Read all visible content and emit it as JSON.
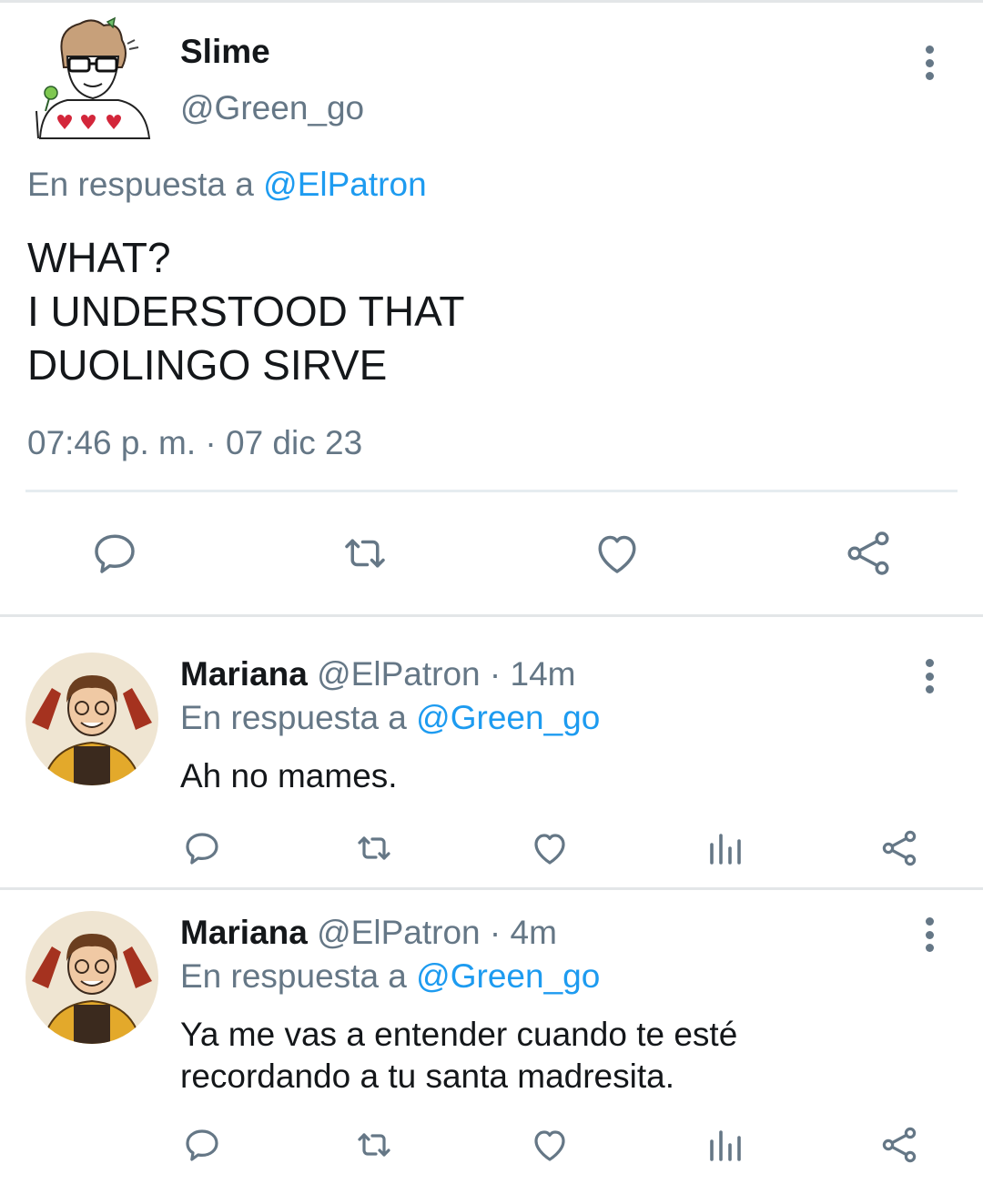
{
  "main_tweet": {
    "name": "Slime",
    "handle": "@Green_go",
    "reply_prefix": "En respuesta a",
    "reply_to": "@ElPatron",
    "body_lines": [
      "WHAT?",
      "I UNDERSTOOD THAT",
      "DUOLINGO SIRVE"
    ],
    "timestamp": "07:46 p. m. · 07 dic 23",
    "avatar_icon": "cartoon-avatar-glasses-hearts-sweater"
  },
  "replies": [
    {
      "name": "Mariana",
      "handle": "@ElPatron",
      "dot": "·",
      "age": "14m",
      "reply_prefix": "En respuesta a",
      "reply_to": "@Green_go",
      "body_lines": [
        "Ah no mames."
      ],
      "avatar_icon": "cartoon-avatar-peace-signs"
    },
    {
      "name": "Mariana",
      "handle": "@ElPatron",
      "dot": "·",
      "age": "4m",
      "reply_prefix": "En respuesta a",
      "reply_to": "@Green_go",
      "body_lines": [
        "Ya me vas a entender cuando te esté",
        "recordando a tu santa madresita."
      ],
      "avatar_icon": "cartoon-avatar-peace-signs"
    }
  ],
  "actions": [
    "reply-icon",
    "retweet-icon",
    "like-icon",
    "views-icon",
    "share-icon"
  ],
  "colors": {
    "link": "#1d9bf0",
    "muted": "#657786",
    "text": "#14171a",
    "divider": "#e3e6e8"
  }
}
